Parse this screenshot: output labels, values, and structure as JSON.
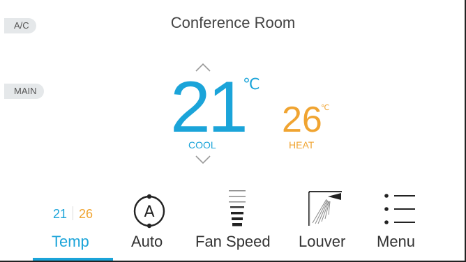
{
  "side_tabs": {
    "ac_label": "A/C",
    "main_label": "MAIN"
  },
  "header": {
    "title": "Conference Room"
  },
  "thermostat": {
    "cool_setpoint": "21",
    "cool_unit": "℃",
    "cool_label": "COOL",
    "heat_setpoint": "26",
    "heat_unit": "℃",
    "heat_label": "HEAT"
  },
  "nav": {
    "temp": {
      "label": "Temp",
      "cool": "21",
      "heat": "26"
    },
    "auto": {
      "label": "Auto",
      "icon_letter": "A"
    },
    "fan_speed": {
      "label": "Fan Speed"
    },
    "louver": {
      "label": "Louver"
    },
    "menu": {
      "label": "Menu"
    },
    "active": "temp"
  },
  "colors": {
    "cool": "#1ba4d9",
    "heat": "#f0a431",
    "pill_bg": "#e5e8ea"
  },
  "icons": {
    "up": "chevron-up-icon",
    "down": "chevron-down-icon",
    "auto": "auto-mode-icon",
    "fan": "fan-speed-icon",
    "louver": "louver-icon",
    "menu": "menu-list-icon"
  }
}
